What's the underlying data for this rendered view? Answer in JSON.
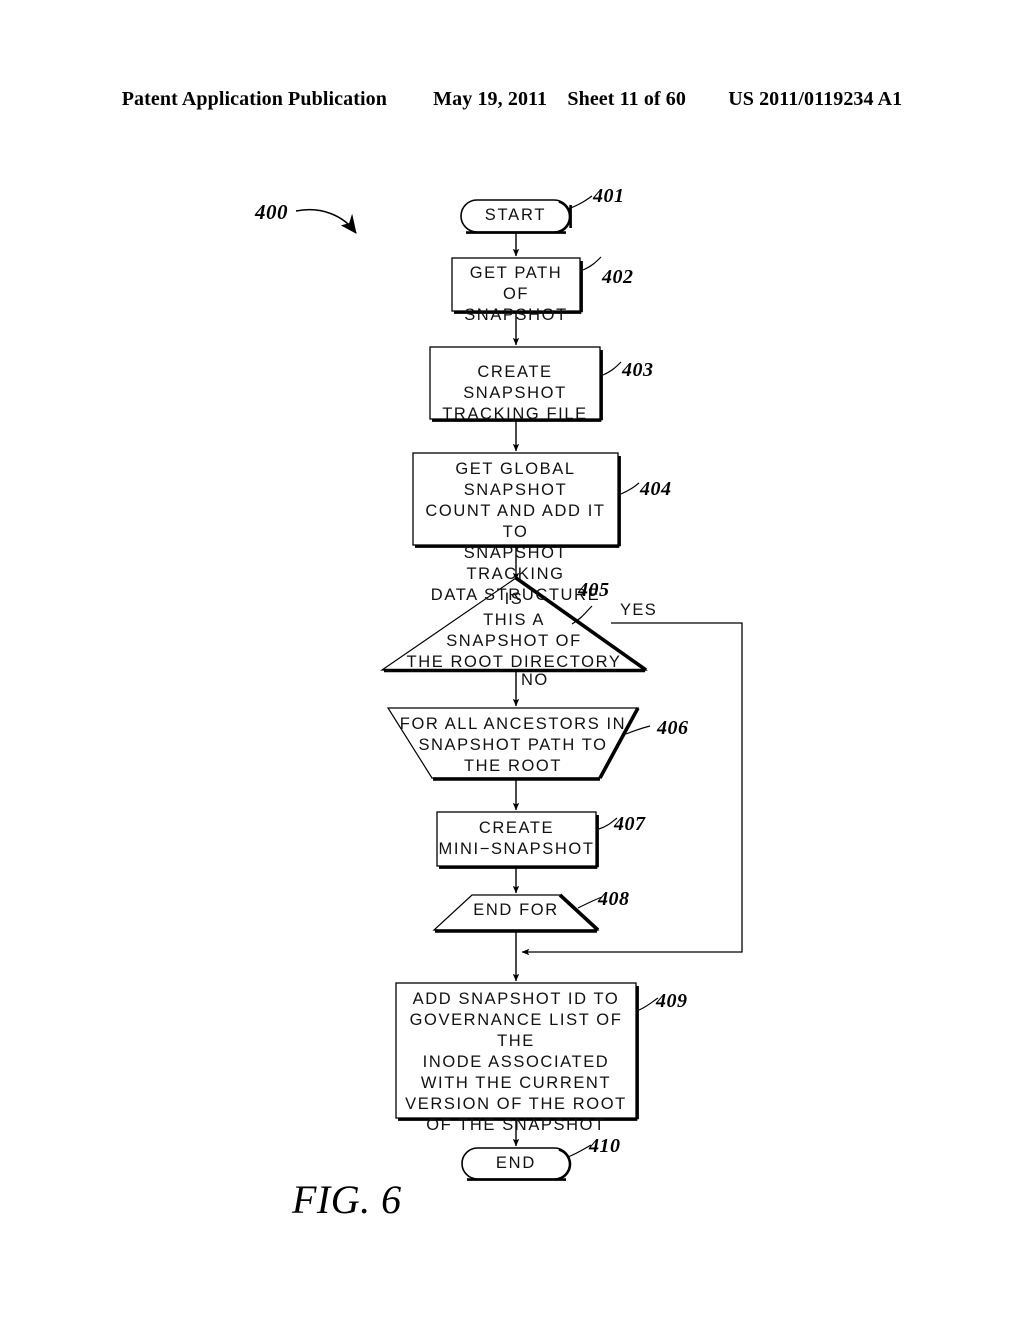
{
  "header": {
    "publication": "Patent Application Publication",
    "date": "May 19, 2011",
    "sheet": "Sheet 11 of 60",
    "patent_number": "US 2011/0119234 A1"
  },
  "figure": {
    "caption": "FIG. 6",
    "diagram_ref": "400",
    "branch_yes": "YES",
    "branch_no": "NO",
    "nodes": {
      "n401": {
        "ref": "401",
        "label": "START",
        "shape": "terminator"
      },
      "n402": {
        "ref": "402",
        "label": "GET PATH\nOF SNAPSHOT",
        "shape": "process"
      },
      "n403": {
        "ref": "403",
        "label": "CREATE SNAPSHOT\nTRACKING FILE",
        "shape": "process"
      },
      "n404": {
        "ref": "404",
        "label": "GET GLOBAL SNAPSHOT\nCOUNT AND ADD IT TO\nSNAPSHOT TRACKING\nDATA STRUCTURE",
        "shape": "process"
      },
      "n405": {
        "ref": "405",
        "label": "IS\nTHIS A\nSNAPSHOT OF\nTHE ROOT DIRECTORY",
        "shape": "decision-triangle"
      },
      "n406": {
        "ref": "406",
        "label": "FOR ALL ANCESTORS IN\nSNAPSHOT PATH TO\nTHE ROOT",
        "shape": "loop-start-trapezoid"
      },
      "n407": {
        "ref": "407",
        "label": "CREATE\nMINI−SNAPSHOT",
        "shape": "process"
      },
      "n408": {
        "ref": "408",
        "label": "END FOR",
        "shape": "loop-end-trapezoid"
      },
      "n409": {
        "ref": "409",
        "label": "ADD SNAPSHOT ID TO\nGOVERNANCE LIST OF THE\nINODE ASSOCIATED\nWITH THE CURRENT\nVERSION OF THE ROOT\nOF THE SNAPSHOT",
        "shape": "process"
      },
      "n410": {
        "ref": "410",
        "label": "END",
        "shape": "terminator"
      }
    }
  },
  "colors": {
    "ink": "#000000",
    "paper": "#ffffff"
  }
}
